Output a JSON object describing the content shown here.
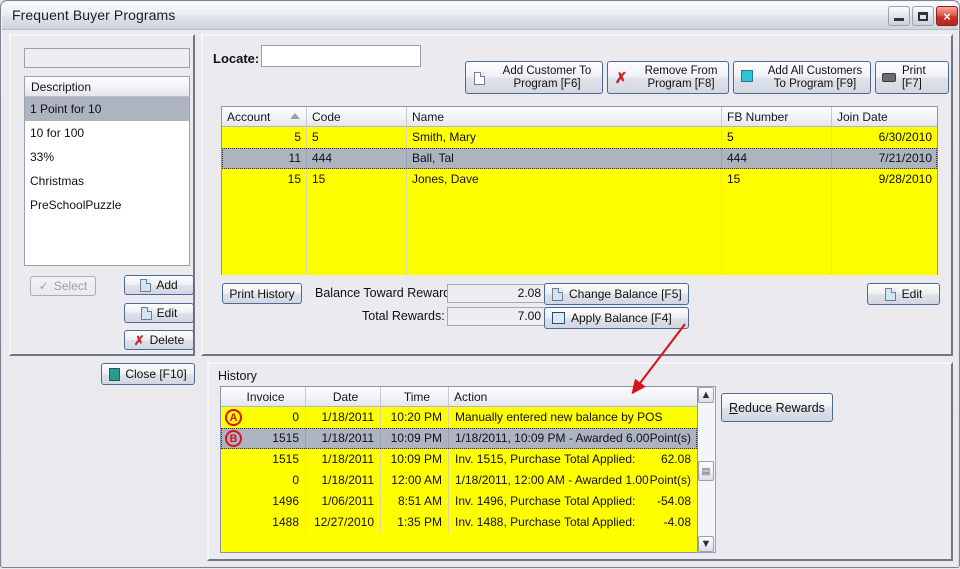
{
  "window": {
    "title": "Frequent Buyer Programs",
    "controls": {
      "minimize": "minimize-button",
      "maximize": "maximize-button",
      "close": "×"
    }
  },
  "left_panel": {
    "filter_value": "",
    "list_header": "Description",
    "items": [
      {
        "label": "1 Point for 10",
        "selected": true
      },
      {
        "label": "10 for 100",
        "selected": false
      },
      {
        "label": "33%",
        "selected": false
      },
      {
        "label": "Christmas",
        "selected": false
      },
      {
        "label": "PreSchoolPuzzle",
        "selected": false
      }
    ],
    "buttons": {
      "select": "Select",
      "add": "Add",
      "edit": "Edit",
      "delete": "Delete",
      "close": "Close [F10]"
    }
  },
  "toolbar": {
    "locate_label": "Locate:",
    "locate_value": "",
    "locate_placeholder": "",
    "add_customer_line1": "Add Customer To",
    "add_customer_line2": "Program [F6]",
    "remove_line1": "Remove From",
    "remove_line2": "Program [F8]",
    "add_all_line1": "Add All Customers",
    "add_all_line2": "To Program [F9]",
    "print": "Print [F7]"
  },
  "customer_grid": {
    "columns": [
      "Account",
      "Code",
      "Name",
      "FB Number",
      "Join Date"
    ],
    "sorted_column": "Account",
    "sort_direction": "asc",
    "rows": [
      {
        "account": "5",
        "code": "5",
        "name": "Smith, Mary",
        "fb_number": "5",
        "join_date": "6/30/2010",
        "selected": false
      },
      {
        "account": "11",
        "code": "444",
        "name": "Ball, Tal",
        "fb_number": "444",
        "join_date": "7/21/2010",
        "selected": true
      },
      {
        "account": "15",
        "code": "15",
        "name": "Jones, Dave",
        "fb_number": "15",
        "join_date": "9/28/2010",
        "selected": false
      }
    ]
  },
  "balance_bar": {
    "print_history": "Print History",
    "balance_label": "Balance Toward Reward:",
    "balance_value": "2.08",
    "total_label": "Total Rewards:",
    "total_value": "7.00",
    "change_balance": "Change Balance [F5]",
    "apply_balance": "Apply Balance [F4]",
    "edit": "Edit"
  },
  "history": {
    "group_label": "History",
    "columns": [
      "Invoice",
      "Date",
      "Time",
      "Action"
    ],
    "rows": [
      {
        "marker": "A",
        "invoice": "0",
        "date": "1/18/2011",
        "time": "10:20 PM",
        "action": "Manually entered new balance by POS",
        "action_suffix": "",
        "selected": false
      },
      {
        "marker": "B",
        "invoice": "1515",
        "date": "1/18/2011",
        "time": "10:09 PM",
        "action": "1/18/2011, 10:09 PM - Awarded 6.00",
        "action_suffix": "Point(s)",
        "selected": true
      },
      {
        "marker": "",
        "invoice": "1515",
        "date": "1/18/2011",
        "time": "10:09 PM",
        "action": "Inv. 1515, Purchase Total Applied:",
        "action_suffix": "62.08",
        "selected": false
      },
      {
        "marker": "",
        "invoice": "0",
        "date": "1/18/2011",
        "time": "12:00 AM",
        "action": "1/18/2011, 12:00 AM - Awarded 1.00",
        "action_suffix": "Point(s)",
        "selected": false
      },
      {
        "marker": "",
        "invoice": "1496",
        "date": "1/06/2011",
        "time": "8:51 AM",
        "action": "Inv. 1496, Purchase Total Applied:",
        "action_suffix": "-54.08",
        "selected": false
      },
      {
        "marker": "",
        "invoice": "1488",
        "date": "12/27/2010",
        "time": "1:35 PM",
        "action": "Inv. 1488, Purchase Total Applied:",
        "action_suffix": "-4.08",
        "selected": false
      }
    ],
    "reduce_rewards": "Reduce Rewards",
    "reduce_rewards_accel": "R"
  },
  "colors": {
    "grid_row": "#ffff00",
    "selected_row": "#aeb3c0",
    "annotation": "#d6161d",
    "window_bg": "#e9e9ee",
    "button_border": "#4b6a99"
  }
}
